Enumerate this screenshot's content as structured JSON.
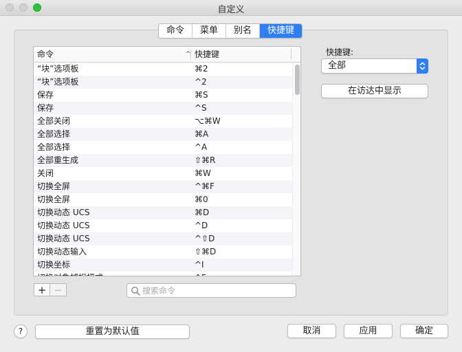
{
  "window": {
    "title": "自定义"
  },
  "tabs": [
    {
      "label": "命令"
    },
    {
      "label": "菜单"
    },
    {
      "label": "别名"
    },
    {
      "label": "快捷键",
      "active": true
    }
  ],
  "table": {
    "headers": {
      "command": "命令",
      "shortcut": "快捷键"
    },
    "sort_indicator": "^",
    "rows": [
      {
        "command": "“块”选项板",
        "shortcut": "⌘2"
      },
      {
        "command": "“块”选项板",
        "shortcut": "^2"
      },
      {
        "command": "保存",
        "shortcut": "⌘S"
      },
      {
        "command": "保存",
        "shortcut": "^S"
      },
      {
        "command": "全部关闭",
        "shortcut": "⌥⌘W"
      },
      {
        "command": "全部选择",
        "shortcut": "⌘A"
      },
      {
        "command": "全部选择",
        "shortcut": "^A"
      },
      {
        "command": "全部重生成",
        "shortcut": "⇧⌘R"
      },
      {
        "command": "关闭",
        "shortcut": "⌘W"
      },
      {
        "command": "切换全屏",
        "shortcut": "^⌘F"
      },
      {
        "command": "切换全屏",
        "shortcut": "⌘0"
      },
      {
        "command": "切换动态 UCS",
        "shortcut": "⌘D"
      },
      {
        "command": "切换动态 UCS",
        "shortcut": "^D"
      },
      {
        "command": "切换动态 UCS",
        "shortcut": "^⇧D"
      },
      {
        "command": "切换动态输入",
        "shortcut": "⇧⌘D"
      },
      {
        "command": "切换坐标",
        "shortcut": "^I"
      },
      {
        "command": "切换对象捕捉模式",
        "shortcut": "^F"
      }
    ]
  },
  "controls": {
    "add": "+",
    "remove": "−"
  },
  "search": {
    "placeholder": "搜索命令"
  },
  "filter": {
    "label": "快捷键:",
    "selected": "全部"
  },
  "buttons": {
    "show_in_finder": "在访达中显示",
    "help": "?",
    "reset": "重置为默认值",
    "cancel": "取消",
    "apply": "应用",
    "ok": "确定"
  },
  "colors": {
    "accent": "#2f7ef4",
    "close_light": "#d0d0d0",
    "zoom_light": "#29c33f"
  }
}
